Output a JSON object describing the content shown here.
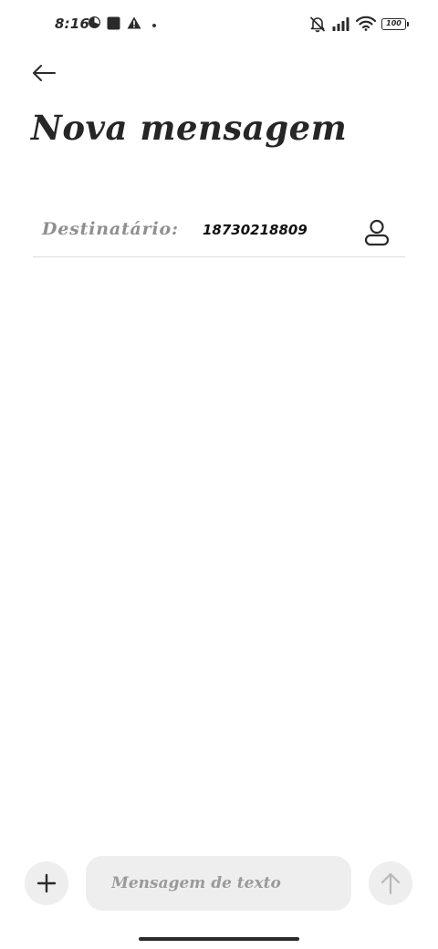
{
  "status_bar": {
    "time": "8:16",
    "battery_level": "100",
    "icons": [
      "pie-clock-icon",
      "square-app-icon",
      "warning-icon",
      "dot-icon",
      "mute-icon",
      "signal-icon",
      "wifi-icon",
      "battery-icon"
    ]
  },
  "header": {
    "back_icon": "arrow-left-icon",
    "title": "Nova mensagem"
  },
  "recipient": {
    "label": "Destinatário:",
    "value": "18730218809",
    "contact_icon": "person-icon"
  },
  "composer": {
    "attach_icon": "plus-icon",
    "placeholder": "Mensagem de texto",
    "send_icon": "arrow-up-icon"
  },
  "colors": {
    "background": "#ffffff",
    "title": "#262626",
    "label_gray": "#8f8f8f",
    "divider": "#dcdcdc",
    "control_bg": "#eeeeee",
    "send_disabled": "#b8b8b8"
  }
}
